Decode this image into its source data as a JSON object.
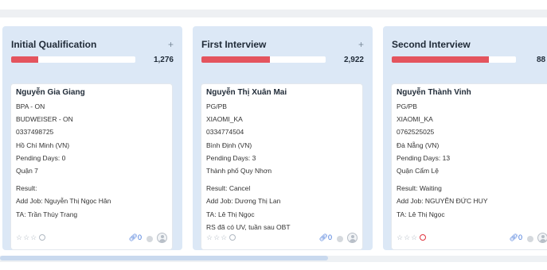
{
  "columns": [
    {
      "title": "Initial Qualification",
      "add": "+",
      "count": "1,276",
      "progress": 0.22,
      "card": {
        "name": "Nguyễn Gia Giang",
        "lines": [
          "BPA - ON",
          "BUDWEISER - ON",
          "0337498725",
          "Hồ Chí Minh (VN)",
          "Pending Days: 0",
          "Quận 7"
        ],
        "result": "Result:",
        "add_job": "Add Job: Nguyễn Thị Ngọc Hân",
        "ta": "TA: Trần Thúy Trang",
        "extra": "",
        "stars": "☆☆☆",
        "attach": "0",
        "status_color": "#b0b8c2"
      }
    },
    {
      "title": "First Interview",
      "add": "+",
      "count": "2,922",
      "progress": 0.55,
      "card": {
        "name": "Nguyễn Thị Xuân Mai",
        "lines": [
          "PG/PB",
          "XIAOMI_KA",
          "0334774504",
          "Bình Định (VN)",
          "Pending Days: 3",
          "Thành phố Quy Nhơn"
        ],
        "result": "Result: Cancel",
        "add_job": "Add Job: Dương Thị Lan",
        "ta": "TA: Lê Thị Ngọc",
        "extra": "RS đã có UV, tuần sau OBT",
        "stars": "☆☆☆",
        "attach": "0",
        "status_color": "#b0b8c2"
      }
    },
    {
      "title": "Second Interview",
      "add": "+",
      "count": "88",
      "progress": 0.78,
      "card": {
        "name": "Nguyễn Thành Vinh",
        "lines": [
          "PG/PB",
          "XIAOMI_KA",
          "0762525025",
          "Đà Nẵng (VN)",
          "Pending Days: 13",
          "Quận Cẩm Lệ"
        ],
        "result": "Result: Waiting",
        "add_job": "Add Job: NGUYỄN ĐỨC HUY",
        "ta": "TA: Lê Thị Ngọc",
        "extra": "",
        "stars": "☆☆☆",
        "attach": "0",
        "status_color": "#e0353f"
      }
    }
  ],
  "colors": {
    "column_bg": "#dce8f6",
    "progress_fill": "#e4545e",
    "attach_color": "#3a6fd8"
  },
  "icons": {
    "add": "plus-icon",
    "attachment": "paperclip-icon",
    "avatar": "user-avatar-icon",
    "status": "status-circle-icon",
    "rating": "star-icon"
  }
}
